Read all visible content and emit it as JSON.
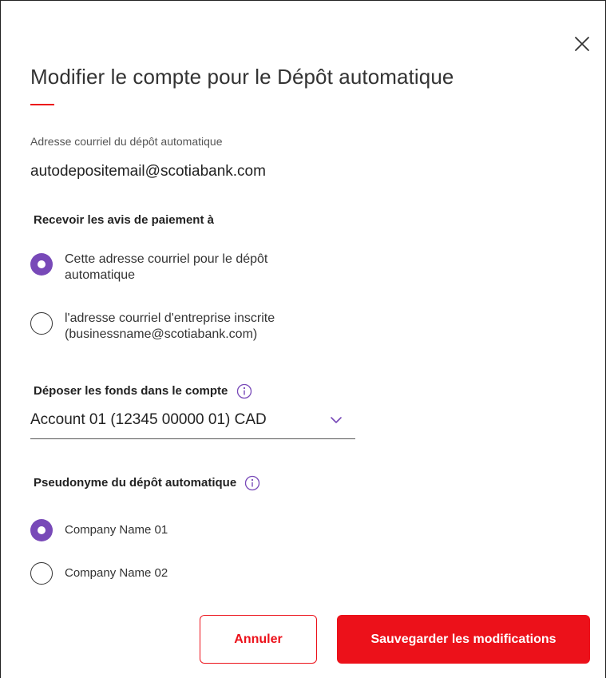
{
  "dialog": {
    "title": "Modifier le compte pour le Dépôt automatique",
    "email_label": "Adresse courriel du dépôt automatique",
    "email_value": "autodepositemail@scotiabank.com"
  },
  "notifications": {
    "label": "Recevoir les avis de paiement à",
    "options": [
      {
        "line1": "Cette adresse courriel pour le dépôt",
        "line2": "automatique",
        "checked": true
      },
      {
        "line1": "l'adresse courriel d'entreprise inscrite",
        "line2": "(businessname@scotiabank.com)",
        "checked": false
      }
    ]
  },
  "deposit_account": {
    "label": "Déposer les fonds dans le compte",
    "selected": "Account 01 (12345 00000 01) CAD"
  },
  "alias": {
    "label": "Pseudonyme du dépôt automatique",
    "options": [
      {
        "label": "Company Name 01",
        "checked": true
      },
      {
        "label": "Company Name 02",
        "checked": false
      }
    ]
  },
  "buttons": {
    "cancel": "Annuler",
    "save": "Sauvegarder les modifications"
  },
  "icons": {
    "close": "close-icon",
    "info": "info-icon",
    "chevron": "chevron-down-icon"
  },
  "colors": {
    "accent_red": "#ec111a",
    "radio_purple": "#7849b8",
    "info_purple": "#7849b8"
  }
}
